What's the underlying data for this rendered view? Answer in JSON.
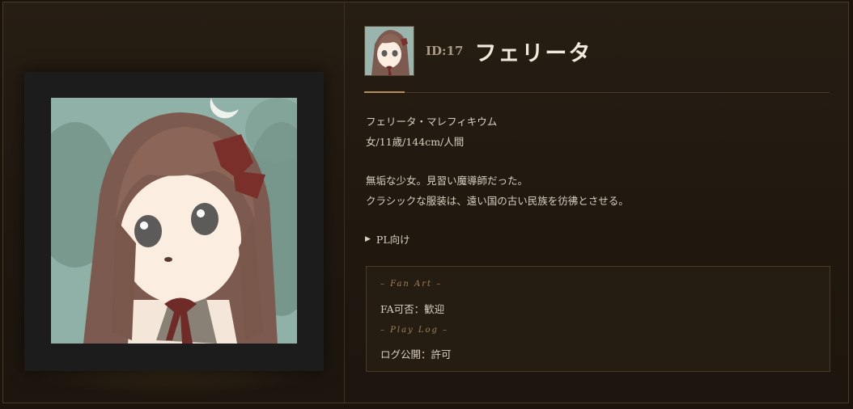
{
  "character": {
    "id_label": "ID:17",
    "name": "フェリータ",
    "full_name": "フェリータ・マレフィキウム",
    "profile_line": "女/11歳/144cm/人間",
    "description_1": "無垢な少女。見習い魔導師だった。",
    "description_2": "クラシックな服装は、遠い国の古い民族を彷彿とさせる。"
  },
  "pl_section": {
    "toggle_label": "PL向け"
  },
  "info_box": {
    "fan_art_heading": "– Fan Art –",
    "fan_art_value": "FA可否：歓迎",
    "play_log_heading": "– Play Log –",
    "play_log_value": "ログ公開：許可"
  },
  "colors": {
    "background": "#1a140d",
    "panel": "#261d13",
    "accent": "#b48e58",
    "text": "#d8cfbf",
    "heading": "#f1e9dc"
  },
  "icons": {
    "pl_toggle": "triangle-right-icon"
  }
}
